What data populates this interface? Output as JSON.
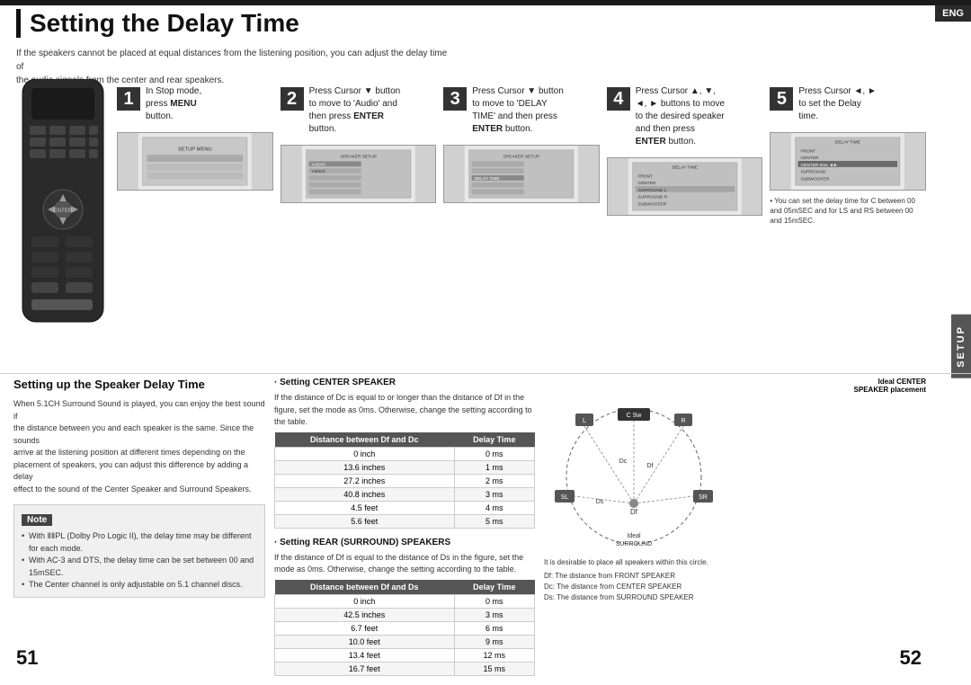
{
  "page": {
    "title": "Setting the Delay Time",
    "subtitle_line1": "If the speakers cannot be placed at equal distances from the listening position, you can adjust the delay time of",
    "subtitle_line2": "the audio signals from the center and rear speakers.",
    "eng_badge": "ENG",
    "setup_tab": "SETUP",
    "page_num_left": "51",
    "page_num_right": "52"
  },
  "steps": [
    {
      "number": "1",
      "text_line1": "In Stop mode,",
      "text_line2": "press ",
      "text_bold": "MENU",
      "text_line3": "button."
    },
    {
      "number": "2",
      "text_line1": "Press Cursor ▼ button",
      "text_line2": "to move to 'Audio' and",
      "text_line3": "then press ",
      "text_bold": "ENTER",
      "text_line4": "button."
    },
    {
      "number": "3",
      "text_line1": "Press Cursor ▼ button",
      "text_line2": "to move to 'DELAY",
      "text_line3": "TIME' and then press",
      "text_bold": "ENTER",
      "text_line4": "button."
    },
    {
      "number": "4",
      "text_line1": "Press Cursor ▲, ▼,",
      "text_line2": "◄, ► buttons to move",
      "text_line3": "to the desired speaker",
      "text_line4": "and then press",
      "text_bold": "ENTER",
      "text_line5": "button."
    },
    {
      "number": "5",
      "text_line1": "Press Cursor ◄, ►",
      "text_line2": "to set the Delay",
      "text_line3": "time.",
      "note": "• You can set the delay time for C between 00 and 05mSEC and for LS and RS between 00 and 15mSEC."
    }
  ],
  "bottom_section": {
    "title": "Setting up the Speaker Delay Time",
    "body": [
      "When 5.1CH Surround Sound is played, you can enjoy the best sound if",
      "the distance between you and each speaker is the same. Since the sounds",
      "arrive at the listening position at different times depending on the",
      "placement of speakers, you can adjust this difference by adding a delay",
      "effect to the sound of the Center Speaker and Surround Speakers."
    ],
    "note_title": "Note",
    "notes": [
      "With ⅡⅡPL (Dolby Pro Logic II), the delay time may be different for each mode.",
      "With AC-3 and DTS, the delay time can be set between 00 and 15mSEC.",
      "The Center channel is only adjustable on 5.1 channel discs."
    ]
  },
  "center_speaker": {
    "title": "· Setting CENTER SPEAKER",
    "body": "If the distance of Dc is equal to or longer than the distance of Df in the figure, set the mode as 0ms. Otherwise, change the setting according to the table.",
    "table_headers": [
      "Distance between Df and Dc",
      "Delay Time"
    ],
    "table_rows": [
      [
        "0 inch",
        "0 ms"
      ],
      [
        "13.6 inches",
        "1 ms"
      ],
      [
        "27.2 inches",
        "2 ms"
      ],
      [
        "40.8 inches",
        "3 ms"
      ],
      [
        "4.5 feet",
        "4 ms"
      ],
      [
        "5.6 feet",
        "5 ms"
      ]
    ]
  },
  "rear_speaker": {
    "title": "· Setting REAR (SURROUND) SPEAKERS",
    "body": "If the distance of Df is equal to the distance of Ds in the figure, set the mode as 0ms. Otherwise, change the setting according to the table.",
    "table_headers": [
      "Distance between Df and Ds",
      "Delay Time"
    ],
    "table_rows": [
      [
        "0 inch",
        "0 ms"
      ],
      [
        "42.5 inches",
        "3 ms"
      ],
      [
        "6.7 feet",
        "6 ms"
      ],
      [
        "10.0 feet",
        "9 ms"
      ],
      [
        "13.4 feet",
        "12 ms"
      ],
      [
        "16.7 feet",
        "15 ms"
      ]
    ]
  },
  "diagram": {
    "title_line1": "Ideal CENTER",
    "title_line2": "SPEAKER placement",
    "circle_note": "It is desirable to place all speakers within this circle.",
    "legend": [
      "Df: The distance from FRONT SPEAKER",
      "Dc: The distance from CENTER SPEAKER",
      "Ds: The distance from SURROUND SPEAKER"
    ],
    "ideal_surround": "Ideal SURROUND SPEAKER placement"
  }
}
